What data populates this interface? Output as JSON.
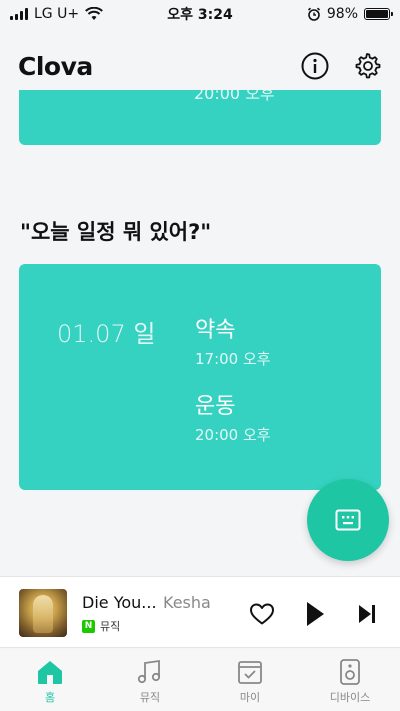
{
  "status_bar": {
    "carrier": "LG U+",
    "time": "오후 3:24",
    "battery": "98%",
    "battery_level": 0.98
  },
  "header": {
    "title": "Clova",
    "info_icon": "info-icon",
    "settings_icon": "gear-icon"
  },
  "partial_card": {
    "peek_text": "20:00 오후"
  },
  "question": "\"오늘 일정 뭐 있어?\"",
  "schedule_card": {
    "date": "01.07 일",
    "events": [
      {
        "title": "약속",
        "time": "17:00 오후"
      },
      {
        "title": "운동",
        "time": "20:00 오후"
      }
    ]
  },
  "fab": {
    "icon": "keyboard-icon",
    "color": "#1fc6a4"
  },
  "player": {
    "title": "Die You...",
    "artist": "Kesha",
    "source_badge": "N",
    "source_label": "뮤직",
    "controls": [
      "heart-icon",
      "play-icon",
      "skip-next-icon"
    ]
  },
  "tabbar": {
    "tabs": [
      {
        "label": "홈",
        "icon": "home-icon",
        "active": true
      },
      {
        "label": "뮤직",
        "icon": "music-note-icon",
        "active": false
      },
      {
        "label": "마이",
        "icon": "calendar-check-icon",
        "active": false
      },
      {
        "label": "디바이스",
        "icon": "speaker-icon",
        "active": false
      }
    ]
  },
  "colors": {
    "accent": "#36d2c1",
    "fab": "#1fc6a4",
    "background": "#f4f5f7"
  }
}
